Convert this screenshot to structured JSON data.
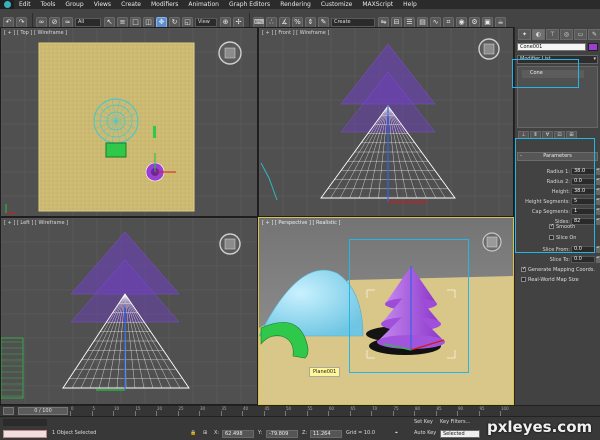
{
  "app": {
    "name": "3ds Max"
  },
  "menubar": {
    "items": [
      "Edit",
      "Tools",
      "Group",
      "Views",
      "Create",
      "Modifiers",
      "Animation",
      "Graph Editors",
      "Rendering",
      "Customize",
      "MAXScript",
      "Help"
    ]
  },
  "toolbar": {
    "selection_filter": "All",
    "ref_coord": "View",
    "selection_set": "Create Selection Se"
  },
  "viewports": {
    "top": {
      "label": "[ + ] [ Top ] [ Wireframe ]"
    },
    "front": {
      "label": "[ + ] [ Front ] [ Wireframe ]"
    },
    "left": {
      "label": "[ + ] [ Left ] [ Wireframe ]"
    },
    "perspective": {
      "label": "[ + ] [ Perspective ] [ Realistic ]",
      "object_tag": "Plane001"
    }
  },
  "command_panel": {
    "object_name": "Cone001",
    "object_color": "#9a3fd0",
    "modifier_list": "Modifier List",
    "stack_item": "Cone",
    "rollout": "Parameters",
    "params": [
      {
        "label": "Radius 1:",
        "value": "38.0"
      },
      {
        "label": "Radius 2:",
        "value": "0.0"
      },
      {
        "label": "Height:",
        "value": "38.0"
      },
      {
        "label": "Height Segments:",
        "value": "5"
      },
      {
        "label": "Cap Segments:",
        "value": "1"
      },
      {
        "label": "Sides:",
        "value": "82"
      }
    ],
    "smooth": "Smooth",
    "slice_on": "Slice On",
    "slice_from": "Slice From:",
    "slice_from_val": "0.0",
    "slice_to": "Slice To:",
    "slice_to_val": "0.0",
    "gen_mapping": "Generate Mapping Coords.",
    "real_world": "Real-World Map Size"
  },
  "timeline": {
    "frame": "0 / 100",
    "ticks": [
      "0",
      "5",
      "10",
      "15",
      "20",
      "25",
      "30",
      "35",
      "40",
      "45",
      "50",
      "55",
      "60",
      "65",
      "70",
      "75",
      "80",
      "85",
      "90",
      "95",
      "100"
    ]
  },
  "status": {
    "selection": "1 Object Selected",
    "x_label": "X:",
    "x": "62.498",
    "y_label": "Y:",
    "y": "-79.809",
    "z_label": "Z:",
    "z": "11.264",
    "grid": "Grid = 10.0",
    "auto_key": "Auto Key",
    "auto_key_mode": "Selected",
    "set_key": "Set Key",
    "key_filters": "Key Filters..."
  },
  "watermark": "pxleyes.com",
  "colors": {
    "highlight": "#22b6ea",
    "cone": "#9a3fd0",
    "grid_yellow": "#d8c76a",
    "viewport_active": "#d9c24a"
  }
}
